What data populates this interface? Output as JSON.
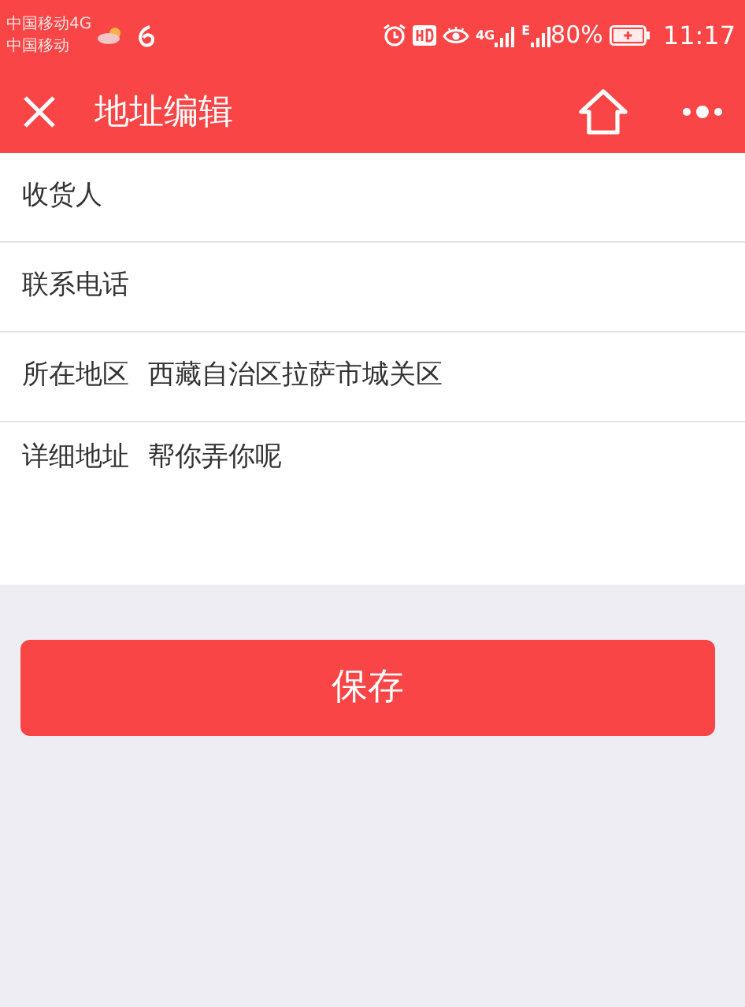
{
  "status_bar": {
    "carrier_1": "中国移动4G",
    "carrier_2": "中国移动",
    "network_1": "4G",
    "network_2": "E",
    "battery": "80%",
    "time": "11:17"
  },
  "nav_bar": {
    "title": "地址编辑"
  },
  "fields": [
    {
      "kind": "line",
      "label": "收货人"
    },
    {
      "kind": "line",
      "label": "联系电话"
    },
    {
      "kind": "line",
      "label": "所在地区",
      "value": "西藏自治区拉萨市城关区"
    },
    {
      "kind": "area",
      "label": "详细地址",
      "value": "帮你弄你呢"
    }
  ],
  "save_button": "保存"
}
